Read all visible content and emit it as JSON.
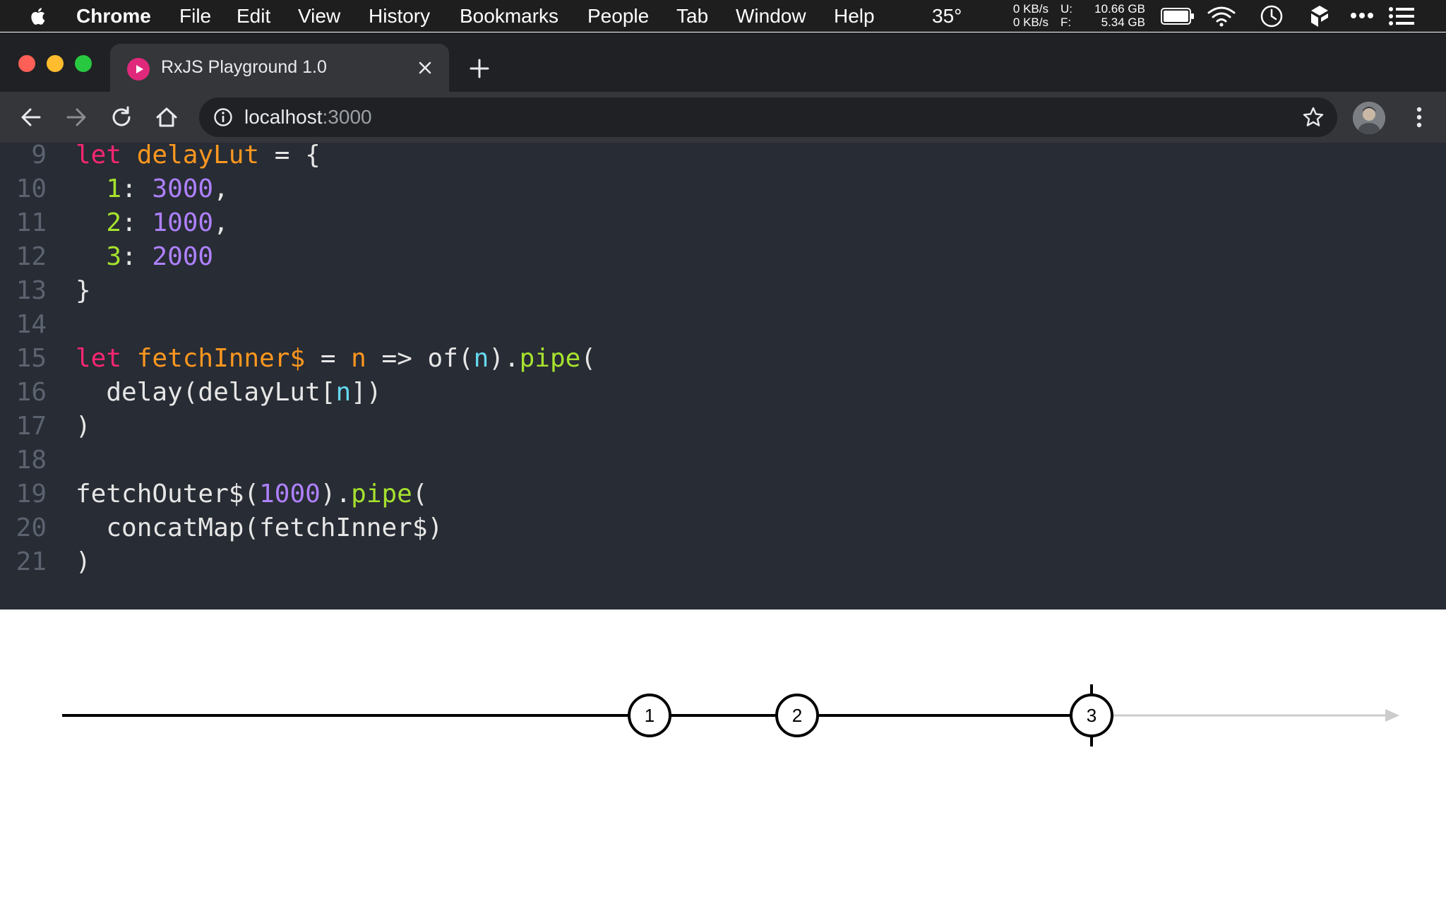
{
  "menubar": {
    "app_name": "Chrome",
    "items": [
      "File",
      "Edit",
      "View",
      "History",
      "Bookmarks",
      "People",
      "Tab",
      "Window",
      "Help"
    ],
    "temperature": "35°",
    "net_up": "0 KB/s",
    "net_down": "0 KB/s",
    "disk_u_label": "U:",
    "disk_f_label": "F:",
    "disk_used": "10.66 GB",
    "disk_free": "5.34 GB",
    "icons": [
      "apple-icon",
      "battery-icon",
      "wifi-icon",
      "clock-icon",
      "app-icon",
      "more-icon",
      "list-icon"
    ]
  },
  "browser": {
    "tab_title": "RxJS Playground 1.0",
    "tab_favicon_color": "#e0297b",
    "url_host": "localhost",
    "url_port": ":3000"
  },
  "editor": {
    "lines": [
      {
        "num": "9",
        "tokens": [
          {
            "t": "let",
            "c": "kw"
          },
          {
            "t": " "
          },
          {
            "t": "delayLut",
            "c": "var"
          },
          {
            "t": " = {"
          }
        ]
      },
      {
        "num": "10",
        "tokens": [
          {
            "t": "  "
          },
          {
            "t": "1",
            "c": "key"
          },
          {
            "t": ": "
          },
          {
            "t": "3000",
            "c": "num"
          },
          {
            "t": ","
          }
        ]
      },
      {
        "num": "11",
        "tokens": [
          {
            "t": "  "
          },
          {
            "t": "2",
            "c": "key"
          },
          {
            "t": ": "
          },
          {
            "t": "1000",
            "c": "num"
          },
          {
            "t": ","
          }
        ]
      },
      {
        "num": "12",
        "tokens": [
          {
            "t": "  "
          },
          {
            "t": "3",
            "c": "key"
          },
          {
            "t": ": "
          },
          {
            "t": "2000",
            "c": "num"
          }
        ]
      },
      {
        "num": "13",
        "tokens": [
          {
            "t": "}"
          }
        ]
      },
      {
        "num": "14",
        "tokens": []
      },
      {
        "num": "15",
        "tokens": [
          {
            "t": "let",
            "c": "kw"
          },
          {
            "t": " "
          },
          {
            "t": "fetchInner$",
            "c": "var"
          },
          {
            "t": " = "
          },
          {
            "t": "n",
            "c": "var"
          },
          {
            "t": " => of("
          },
          {
            "t": "n",
            "c": "param"
          },
          {
            "t": ")."
          },
          {
            "t": "pipe",
            "c": "fn"
          },
          {
            "t": "("
          }
        ]
      },
      {
        "num": "16",
        "tokens": [
          {
            "t": "  delay(delayLut["
          },
          {
            "t": "n",
            "c": "param"
          },
          {
            "t": "])"
          }
        ]
      },
      {
        "num": "17",
        "tokens": [
          {
            "t": ")"
          }
        ]
      },
      {
        "num": "18",
        "tokens": []
      },
      {
        "num": "19",
        "tokens": [
          {
            "t": "fetchOuter$("
          },
          {
            "t": "1000",
            "c": "num"
          },
          {
            "t": ")."
          },
          {
            "t": "pipe",
            "c": "fn"
          },
          {
            "t": "("
          }
        ]
      },
      {
        "num": "20",
        "tokens": [
          {
            "t": "  concatMap(fetchInner$)"
          }
        ]
      },
      {
        "num": "21",
        "tokens": [
          {
            "t": ")"
          }
        ]
      }
    ]
  },
  "marble": {
    "values": [
      "1",
      "2",
      "3"
    ],
    "completed_at": "3",
    "active_color": "#000000",
    "pending_color": "#cccccc"
  }
}
